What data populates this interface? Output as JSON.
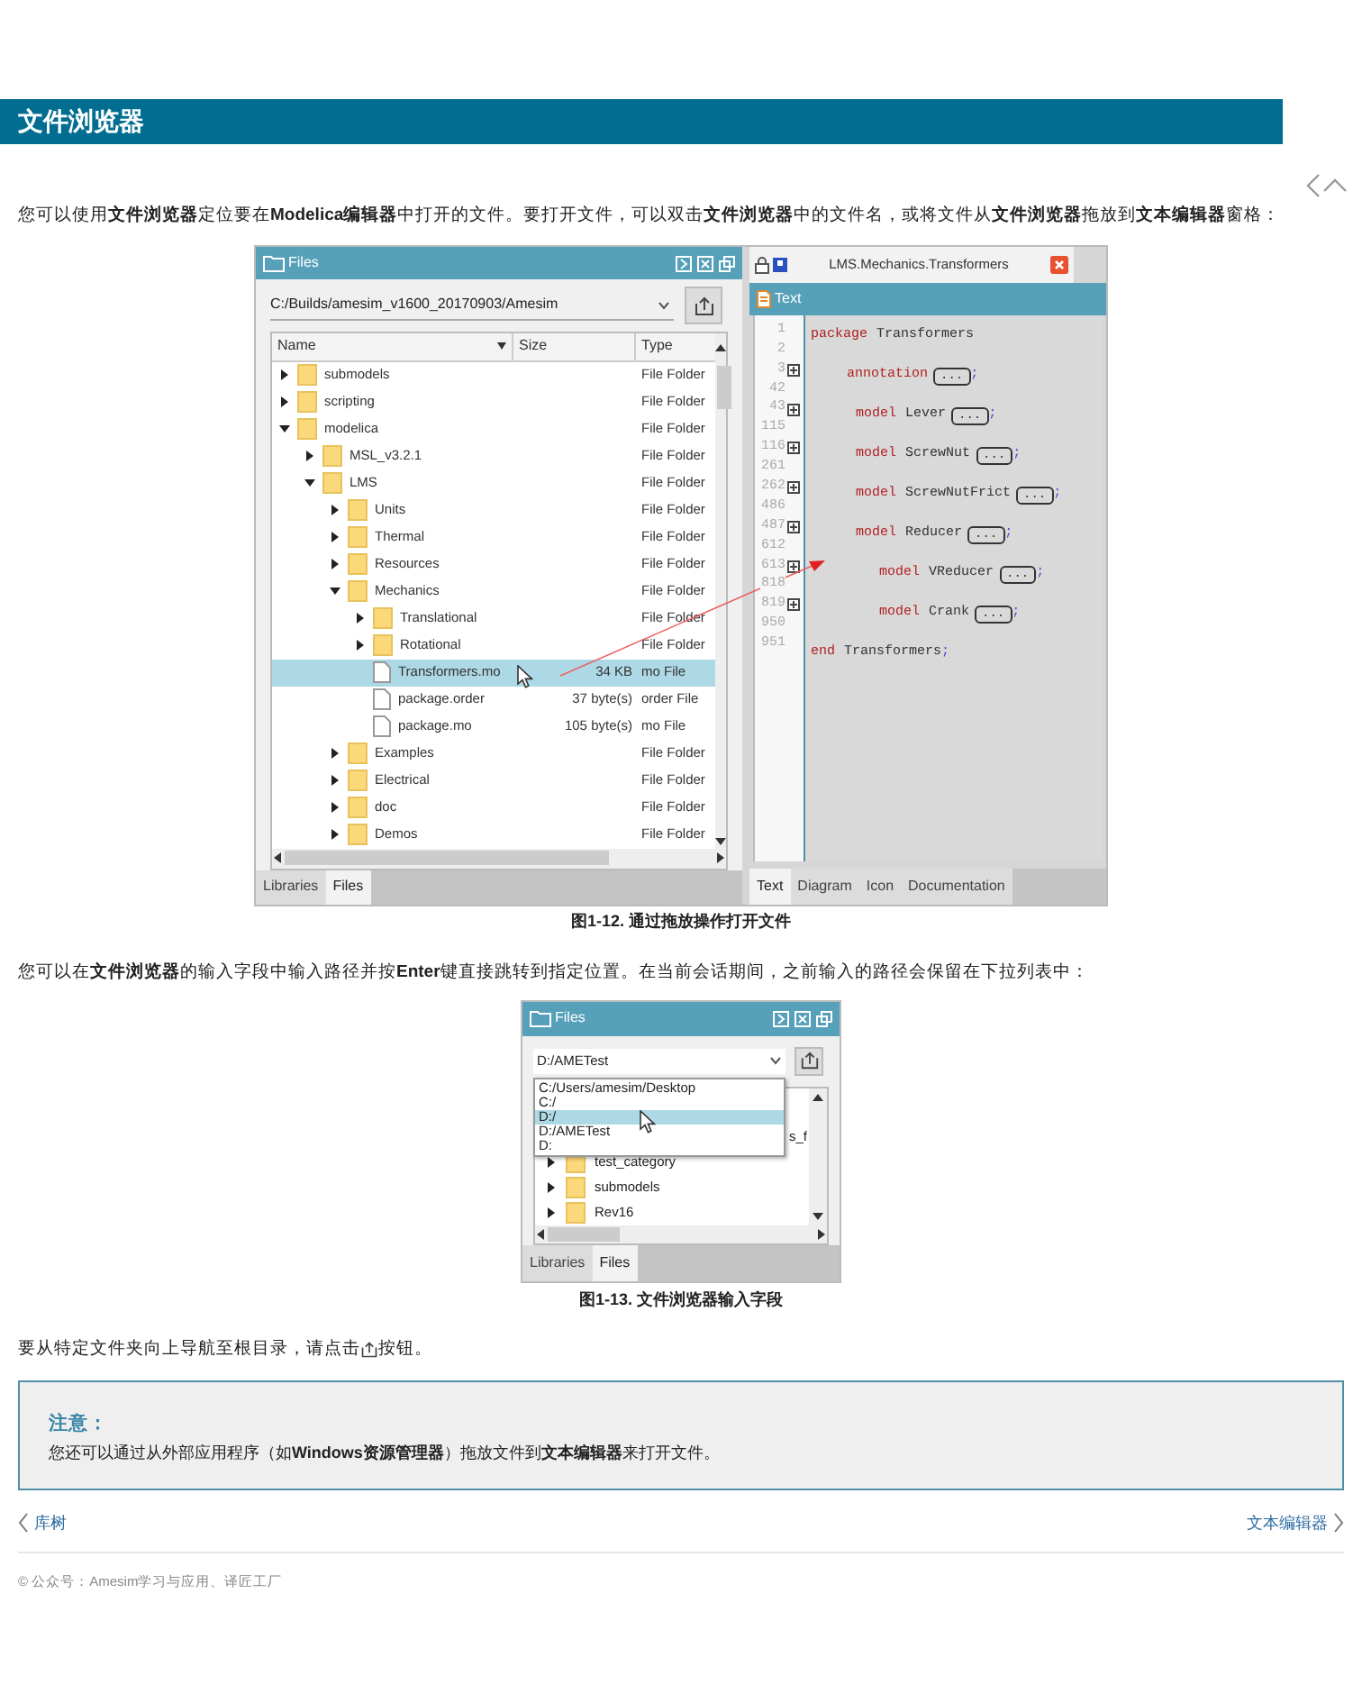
{
  "page_title": "文件浏览器",
  "intro": "您可以使用**文件浏览器**定位要在**Modelica编辑器**中打开的文件。要打开文件，可以双击**文件浏览器**中的文件名，或将文件从**文件浏览器**拖放到**文本编辑器**窗格：",
  "figure_1": {
    "files_panel": {
      "title": "Files",
      "path": "C:/Builds/amesim_v1600_20170903/Amesim",
      "columns": [
        "Name",
        "Size",
        "Type"
      ],
      "rows": [
        {
          "name": "submodels",
          "type": "File Folder",
          "kind": "folder",
          "expanded": false,
          "selected": false
        },
        {
          "name": "scripting",
          "type": "File Folder",
          "kind": "folder",
          "expanded": false,
          "selected": false
        },
        {
          "name": "modelica",
          "type": "File Folder",
          "kind": "folder",
          "expanded": true,
          "selected": false,
          "children": [
            {
              "name": "MSL_v3.2.1",
              "type": "File Folder",
              "kind": "folder",
              "expanded": false,
              "selected": false
            },
            {
              "name": "LMS",
              "type": "File Folder",
              "kind": "folder",
              "expanded": true,
              "selected": false,
              "children": [
                {
                  "name": "Units",
                  "type": "File Folder",
                  "kind": "folder",
                  "expanded": false,
                  "selected": false
                },
                {
                  "name": "Thermal",
                  "type": "File Folder",
                  "kind": "folder",
                  "expanded": false,
                  "selected": false
                },
                {
                  "name": "Resources",
                  "type": "File Folder",
                  "kind": "folder",
                  "expanded": false,
                  "selected": false
                },
                {
                  "name": "Mechanics",
                  "type": "File Folder",
                  "kind": "folder",
                  "expanded": true,
                  "selected": false,
                  "children": [
                    {
                      "name": "Translational",
                      "type": "File Folder",
                      "kind": "folder",
                      "expanded": false,
                      "selected": false
                    },
                    {
                      "name": "Rotational",
                      "type": "File Folder",
                      "kind": "folder",
                      "expanded": false,
                      "selected": false
                    },
                    {
                      "name": "Transformers.mo",
                      "size": "34 KB",
                      "type": "mo File",
                      "kind": "file",
                      "selected": true
                    },
                    {
                      "name": "package.order",
                      "size": "37 byte(s)",
                      "type": "order File",
                      "kind": "file",
                      "selected": false
                    },
                    {
                      "name": "package.mo",
                      "size": "105 byte(s)",
                      "type": "mo File",
                      "kind": "file",
                      "selected": false
                    }
                  ]
                },
                {
                  "name": "Examples",
                  "type": "File Folder",
                  "kind": "folder",
                  "expanded": false,
                  "selected": false
                },
                {
                  "name": "Electrical",
                  "type": "File Folder",
                  "kind": "folder",
                  "expanded": false,
                  "selected": false
                },
                {
                  "name": "doc",
                  "type": "File Folder",
                  "kind": "folder",
                  "expanded": false,
                  "selected": false
                },
                {
                  "name": "Demos",
                  "type": "File Folder",
                  "kind": "folder",
                  "expanded": false,
                  "selected": false
                }
              ]
            }
          ]
        }
      ],
      "tabs": [
        {
          "label": "Libraries",
          "selected": false
        },
        {
          "label": "Files",
          "selected": true
        }
      ]
    },
    "editor": {
      "title": "LMS.Mechanics.Transformers",
      "view": "Text",
      "gutter": [
        {
          "number": "1",
          "fold": false
        },
        {
          "number": "2",
          "fold": false
        },
        {
          "number": "3",
          "fold": true
        },
        {
          "number": "42",
          "fold": false
        },
        {
          "number": "43",
          "fold": true
        },
        {
          "number": "115",
          "fold": false
        },
        {
          "number": "116",
          "fold": true
        },
        {
          "number": "261",
          "fold": false
        },
        {
          "number": "262",
          "fold": true
        },
        {
          "number": "486",
          "fold": false
        },
        {
          "number": "487",
          "fold": true
        },
        {
          "number": "612",
          "fold": false
        },
        {
          "number": "613",
          "fold": true
        },
        {
          "number": "818",
          "fold": false
        },
        {
          "number": "819",
          "fold": true
        },
        {
          "number": "950",
          "fold": false
        },
        {
          "number": "951",
          "fold": false
        }
      ],
      "code": [
        {
          "keyword": "package",
          "name": "Transformers",
          "children": [
            {
              "keyword": "annotation",
              "fold_text": "...",
              "end": ";"
            },
            {
              "keyword": "model",
              "name": "Lever",
              "fold_text": "...",
              "end": ";"
            },
            {
              "keyword": "model",
              "name": "ScrewNut",
              "fold_text": "...",
              "end": ";"
            },
            {
              "keyword": "model",
              "name": "ScrewNutFrict",
              "fold_text": "...",
              "end": ";"
            },
            {
              "keyword": "model",
              "name": "Reducer",
              "fold_text": "...",
              "end": ";",
              "children": [
                {
                  "keyword": "model",
                  "name": "VReducer",
                  "fold_text": "...",
                  "end": ";"
                },
                {
                  "keyword": "model",
                  "name": "Crank",
                  "fold_text": "...",
                  "end": ";"
                }
              ]
            }
          ]
        },
        {
          "keyword": "end",
          "name": "Transformers",
          "end": ";"
        }
      ],
      "tabs": [
        {
          "label": "Text",
          "selected": true
        },
        {
          "label": "Diagram",
          "selected": false
        },
        {
          "label": "Icon",
          "selected": false
        },
        {
          "label": "Documentation",
          "selected": false
        }
      ]
    },
    "caption": "图1-12. 通过拖放操作打开文件"
  },
  "paragraph_2": "您可以在**文件浏览器**的输入字段中输入路径并按**Enter**键直接跳转到指定位置。在当前会话期间，之前输入的路径会保留在下拉列表中：",
  "figure_2": {
    "files_panel": {
      "title": "Files",
      "path": "D:/AMETest",
      "dropdown": [
        {
          "label": "C:/Users/amesim/Desktop",
          "selected": false
        },
        {
          "label": "C:/",
          "selected": false
        },
        {
          "label": "D:/",
          "selected": true
        },
        {
          "label": "D:/AMETest",
          "selected": false
        },
        {
          "label": "D:",
          "selected": false
        }
      ],
      "partial_row": "s_f",
      "rows": [
        {
          "name": "test_category",
          "kind": "folder",
          "expanded": false
        },
        {
          "name": "submodels",
          "kind": "folder",
          "expanded": false
        },
        {
          "name": "Rev16",
          "kind": "folder",
          "expanded": false
        }
      ],
      "tabs": [
        {
          "label": "Libraries",
          "selected": false
        },
        {
          "label": "Files",
          "selected": true
        }
      ]
    },
    "caption": "图1-13. 文件浏览器输入字段"
  },
  "paragraph_3_before": "要从特定文件夹向上导航至根目录，请点击",
  "paragraph_3_after": "按钮。",
  "note": {
    "title": "注意：",
    "text": "您还可以通过从外部应用程序（如**Windows资源管理器**）拖放文件到**文本编辑器**来打开文件。"
  },
  "prev_link": "库树",
  "next_link": "文本编辑器",
  "footer": "© 公众号：Amesim学习与应用、译匠工厂"
}
